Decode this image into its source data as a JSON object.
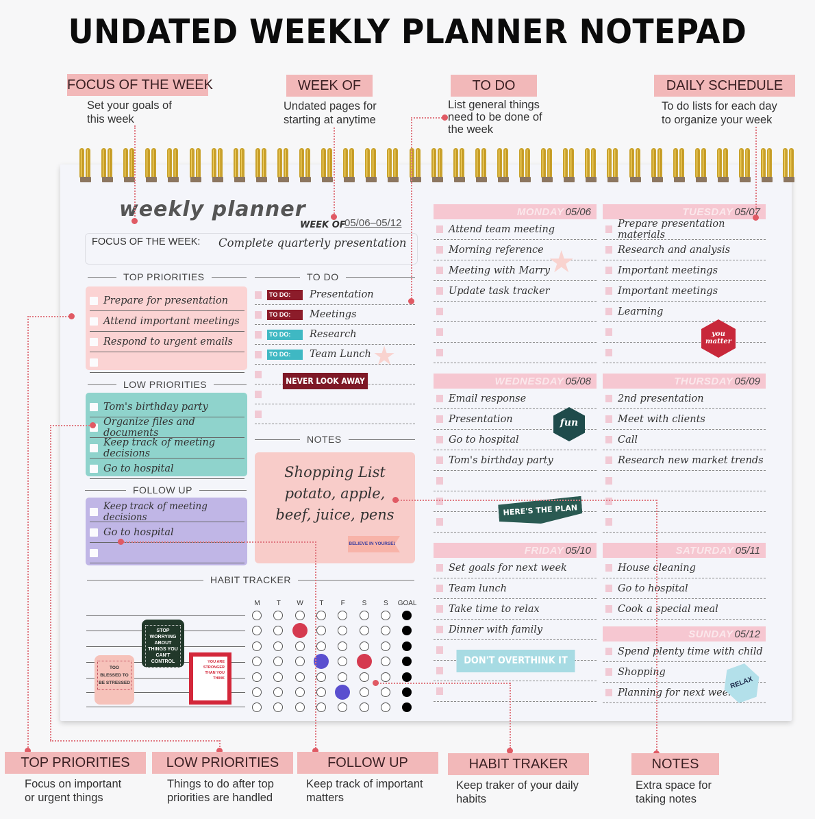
{
  "title": "UNDATED WEEKLY PLANNER NOTEPAD",
  "top_callouts": [
    {
      "label": "FOCUS OF THE WEEK",
      "desc_line1": "Set your goals of",
      "desc_line2": "this week"
    },
    {
      "label": "WEEK OF",
      "desc_line1": "Undated pages for",
      "desc_line2": "starting at anytime"
    },
    {
      "label": "TO DO",
      "desc_line1": "List general things",
      "desc_line2": "need to be done of",
      "desc_line3": "the week"
    },
    {
      "label": "DAILY SCHEDULE",
      "desc_line1": "To do lists for each day",
      "desc_line2": "to organize your week"
    }
  ],
  "bottom_callouts": [
    {
      "label": "TOP PRIORITIES",
      "desc_line1": "Focus on important",
      "desc_line2": "or urgent things"
    },
    {
      "label": "LOW PRIORITIES",
      "desc_line1": "Things to do after top",
      "desc_line2": "priorities are handled"
    },
    {
      "label": "FOLLOW UP",
      "desc_line1": "Keep track of important",
      "desc_line2": "matters"
    },
    {
      "label": "HABIT TRAKER",
      "desc_line1": "Keep traker of your daily",
      "desc_line2": "habits"
    },
    {
      "label": "NOTES",
      "desc_line1": "Extra space for",
      "desc_line2": "taking notes"
    }
  ],
  "planner": {
    "title": "weekly planner",
    "week_of_label": "WEEK OF",
    "week_of_value": "05/06–05/12",
    "focus_label": "FOCUS OF THE WEEK:",
    "focus_value": "Complete quarterly presentation",
    "top_priorities": {
      "heading": "TOP PRIORITIES",
      "items": [
        "Prepare for presentation",
        "Attend important meetings",
        "Respond to urgent emails",
        ""
      ]
    },
    "low_priorities": {
      "heading": "LOW PRIORITIES",
      "items": [
        "Tom's birthday party",
        "Organize files and documents",
        "Keep track of meeting decisions",
        "Go to hospital"
      ]
    },
    "follow_up": {
      "heading": "FOLLOW UP",
      "items": [
        "Keep track of meeting decisions",
        "Go to hospital",
        ""
      ]
    },
    "todo": {
      "heading": "TO DO",
      "tag_label": "TO DO:",
      "items": [
        {
          "text": "Presentation",
          "tag_color": "#8c1c2a"
        },
        {
          "text": "Meetings",
          "tag_color": "#8c1c2a"
        },
        {
          "text": "Research",
          "tag_color": "#3fb8c3"
        },
        {
          "text": "Team Lunch",
          "tag_color": "#3fb8c3"
        },
        {
          "text": "",
          "tag_color": null
        },
        {
          "text": "",
          "tag_color": null
        },
        {
          "text": "",
          "tag_color": null
        }
      ]
    },
    "notes": {
      "heading": "NOTES",
      "lines": [
        "Shopping List",
        "potato, apple,",
        "beef, juice, pens"
      ]
    },
    "habit_tracker": {
      "heading": "HABIT TRACKER",
      "columns": [
        "M",
        "T",
        "W",
        "T",
        "F",
        "S",
        "S",
        "GOAL"
      ],
      "filled": [
        {
          "row": 2,
          "col": 3,
          "color": "red"
        },
        {
          "row": 4,
          "col": 4,
          "color": "blue"
        },
        {
          "row": 4,
          "col": 6,
          "color": "red"
        },
        {
          "row": 6,
          "col": 5,
          "color": "blue"
        }
      ],
      "rows": 7
    },
    "days": [
      {
        "name": "MONDAY",
        "date": "05/06",
        "items": [
          "Attend  team meeting",
          "Morning reference",
          "Meeting with Marry",
          "Update task tracker",
          "",
          "",
          ""
        ]
      },
      {
        "name": "TUESDAY",
        "date": "05/07",
        "items": [
          "Prepare presentation materials",
          "Research and analysis",
          "Important meetings",
          "Important meetings",
          "Learning",
          "",
          ""
        ]
      },
      {
        "name": "WEDNESDAY",
        "date": "05/08",
        "items": [
          "Email response",
          "Presentation",
          "Go to hospital",
          "Tom's birthday party",
          "",
          "",
          ""
        ]
      },
      {
        "name": "THURSDAY",
        "date": "05/09",
        "items": [
          "2nd presentation",
          "Meet with clients",
          "Call",
          "Research new market trends",
          "",
          "",
          ""
        ]
      },
      {
        "name": "FRIDAY",
        "date": "05/10",
        "items": [
          "Set goals for next week",
          "Team lunch",
          "Take time to relax",
          "Dinner with family",
          "",
          "",
          ""
        ]
      },
      {
        "name": "SATURDAY",
        "date": "05/11",
        "items": [
          "House cleaning",
          "Go to hospital",
          "Cook a special meal"
        ]
      },
      {
        "name": "SUNDAY",
        "date": "05/12",
        "items": [
          "Spend plenty time with child",
          "Shopping",
          "Planning for next week"
        ]
      }
    ],
    "stickers": {
      "never_look_away": "NEVER LOOK AWAY",
      "believe": "BELIEVE IN YOURSELF",
      "you_matter": "you matter",
      "fun": "fun",
      "heres_the_plan": "HERE'S THE PLAN",
      "dont_overthink": "DON'T OVERTHINK IT",
      "relax": "RELAX",
      "stop_worrying": "STOP WORRYING ABOUT THINGS YOU CAN'T CONTROL",
      "too_blessed": "TOO BLESSED TO BE STRESSED",
      "stronger": "YOU ARE STRONGER THAN YOU THINK"
    }
  }
}
